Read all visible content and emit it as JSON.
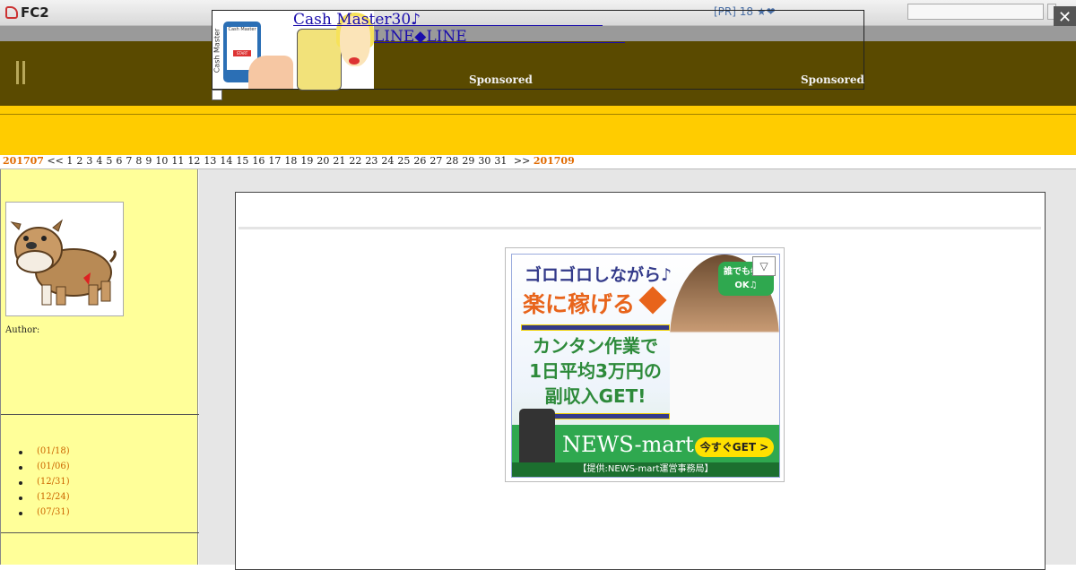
{
  "topbar": {
    "logo_text": "FC2",
    "pr_text": "[PR] 18 ★❤",
    "search_placeholder": "",
    "close_label": "✕"
  },
  "ad_overlay": {
    "link1": "Cash Master30♪",
    "link2": "LINE◆LINE",
    "sponsored_left": "Sponsored",
    "sponsored_right": "Sponsored",
    "image_vertical_text": "Cash Master",
    "phone_text": "Cash Master",
    "phone_button": "START"
  },
  "calendar": {
    "prev_month": "201707",
    "prev_arrow": "<<",
    "days": [
      "1",
      "2",
      "3",
      "4",
      "5",
      "6",
      "7",
      "8",
      "9",
      "10",
      "11",
      "12",
      "13",
      "14",
      "15",
      "16",
      "17",
      "18",
      "19",
      "20",
      "21",
      "22",
      "23",
      "24",
      "25",
      "26",
      "27",
      "28",
      "29",
      "30",
      "31"
    ],
    "next_arrow": ">>",
    "next_month": "201709"
  },
  "sidebar": {
    "author_label": "Author:",
    "recent_entries": [
      "(01/18)",
      "(01/06)",
      "(12/31)",
      "(12/24)",
      "(07/31)"
    ]
  },
  "banner": {
    "line1": "ゴロゴロしながら♪",
    "line2": "楽に稼げる",
    "copy1": "カンタン作業で",
    "copy2": "1日平均3万円の",
    "copy3": "副収入GET!",
    "bubble": "誰でも参加OK♫",
    "brand": "NEWS-mart",
    "cta": "今すぐGET >",
    "provider": "【提供:NEWS-mart運営事務局】",
    "ad_choice": "▽"
  },
  "colors": {
    "header_brown": "#5a4a00",
    "yellow_band": "#ffcc00",
    "sidebar_yellow": "#ffff99",
    "month_orange": "#e06a00"
  }
}
